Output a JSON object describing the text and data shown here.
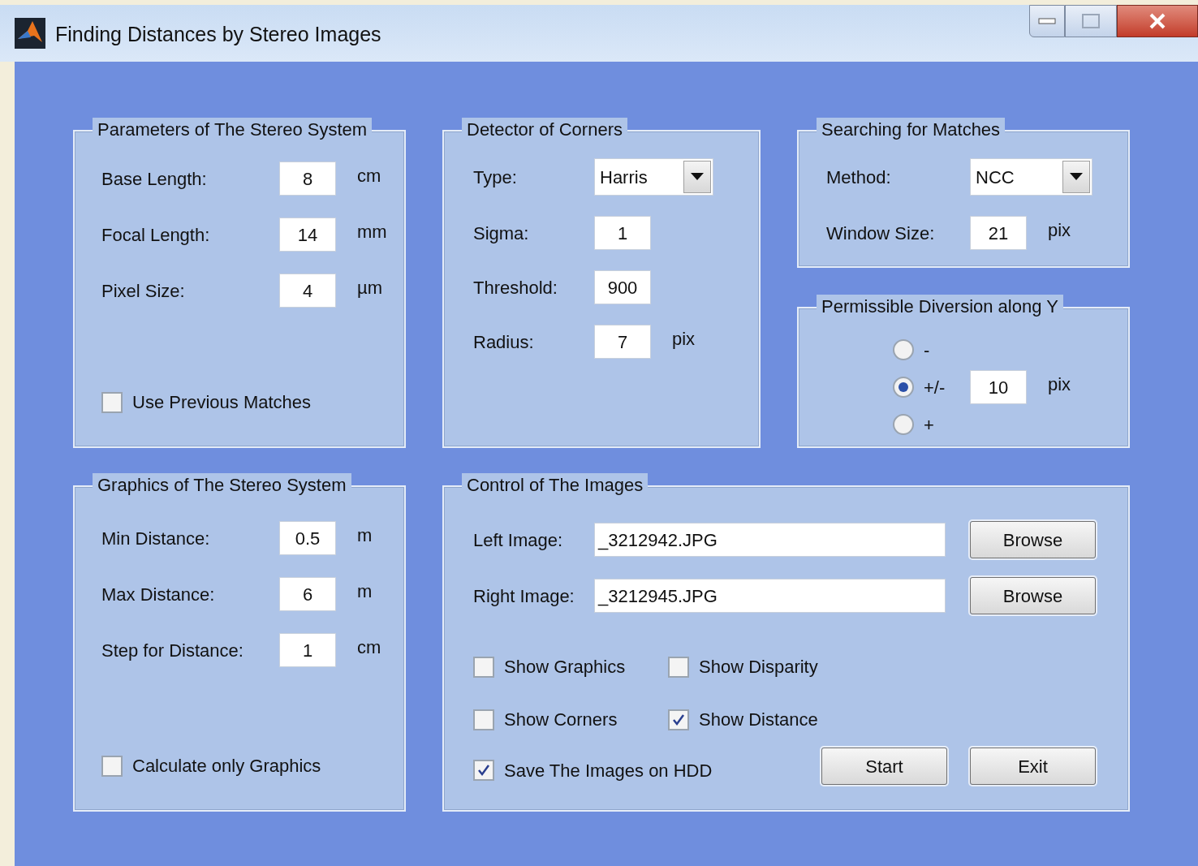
{
  "window": {
    "title": "Finding Distances by Stereo Images"
  },
  "stereo_parameters": {
    "title": "Parameters of The Stereo System",
    "fields": [
      {
        "label": "Base Length:",
        "value": "8",
        "unit": "cm"
      },
      {
        "label": "Focal Length:",
        "value": "14",
        "unit": "mm"
      },
      {
        "label": "Pixel Size:",
        "value": "4",
        "unit": "µm"
      }
    ],
    "option": {
      "label": "Use Previous Matches",
      "checked": false
    }
  },
  "corner_detector": {
    "title": "Detector of Corners",
    "type": {
      "label": "Type:",
      "value": "Harris"
    },
    "fields": [
      {
        "label": "Sigma:",
        "value": "1"
      },
      {
        "label": "Threshold:",
        "value": "900"
      },
      {
        "label": "Radius:",
        "value": "7",
        "unit": "pix"
      }
    ]
  },
  "matching": {
    "title": "Searching for Matches",
    "method": {
      "label": "Method:",
      "value": "NCC"
    },
    "fields": [
      {
        "label": "Window Size:",
        "value": "21",
        "unit": "pix"
      }
    ]
  },
  "y_diversion": {
    "title": "Permissible Diversion along Y",
    "options": [
      {
        "label": "-",
        "selected": false
      },
      {
        "label": "+/-",
        "selected": true
      },
      {
        "label": "+",
        "selected": false
      }
    ],
    "value": "10",
    "unit": "pix"
  },
  "graphics": {
    "title": "Graphics of The Stereo System",
    "fields": [
      {
        "label": "Min Distance:",
        "value": "0.5",
        "unit": "m"
      },
      {
        "label": "Max Distance:",
        "value": "6",
        "unit": "m"
      },
      {
        "label": "Step for Distance:",
        "value": "1",
        "unit": "cm"
      }
    ],
    "option": {
      "label": "Calculate only Graphics",
      "checked": false
    }
  },
  "image_control": {
    "title": "Control of The Images",
    "images": [
      {
        "label": "Left Image:",
        "value": "_3212942.JPG",
        "button": "Browse"
      },
      {
        "label": "Right Image:",
        "value": "_3212945.JPG",
        "button": "Browse"
      }
    ],
    "options": [
      {
        "label": "Show Graphics",
        "checked": false
      },
      {
        "label": "Show Disparity",
        "checked": false
      },
      {
        "label": "Show Corners",
        "checked": false
      },
      {
        "label": "Show Distance",
        "checked": true
      }
    ],
    "save": {
      "label": "Save The Images on HDD",
      "checked": true
    },
    "buttons": [
      "Start",
      "Exit"
    ]
  }
}
